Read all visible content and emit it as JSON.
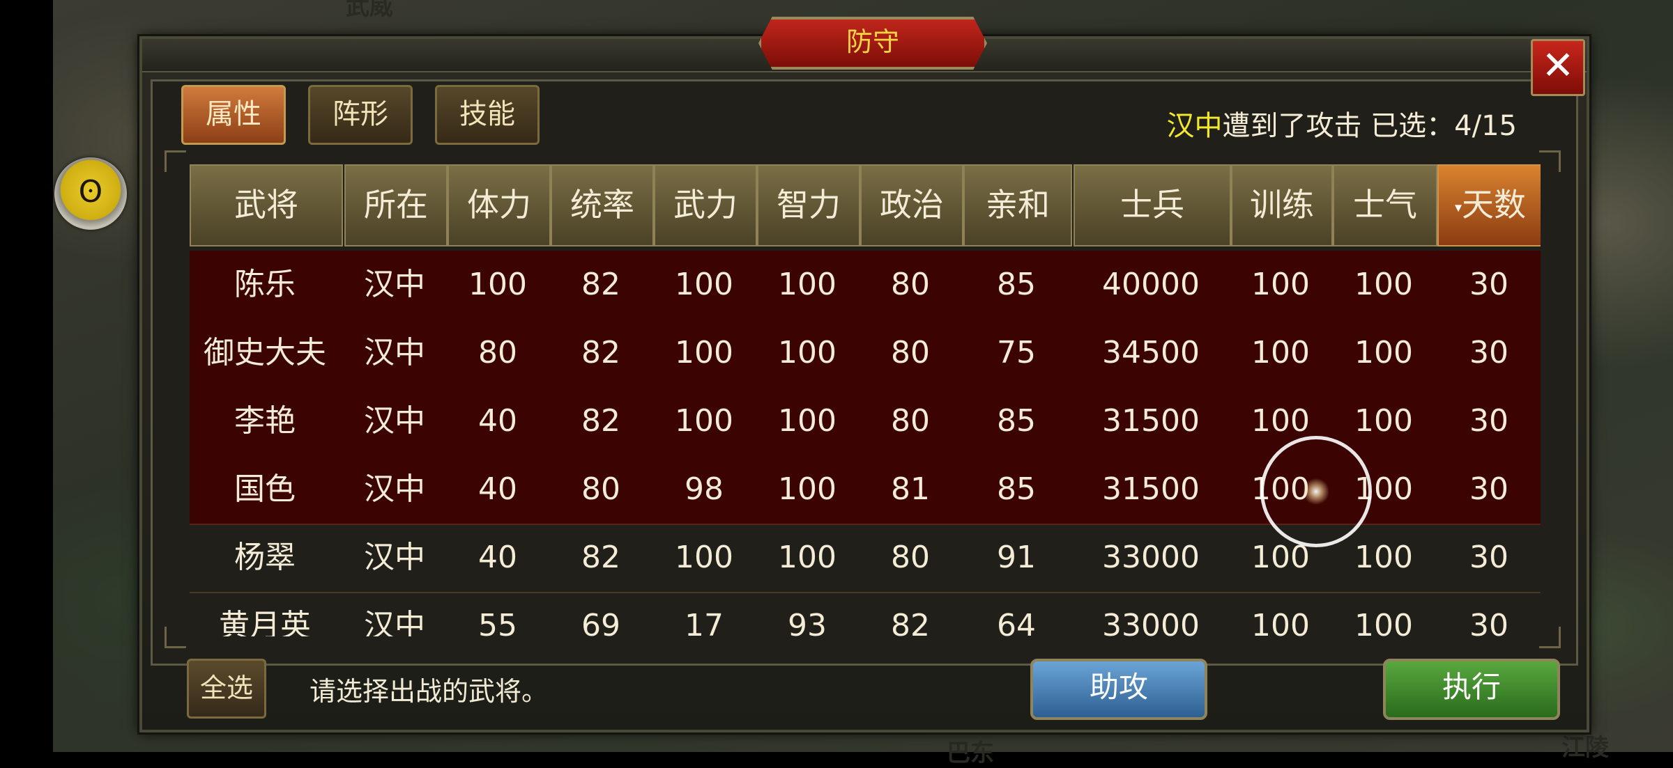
{
  "map": {
    "town_labels": [
      "武威",
      "江陵",
      "巴东"
    ]
  },
  "avatar_glyph": "ʘ",
  "dialog": {
    "title": "防守",
    "close_label": "✕",
    "tabs": [
      {
        "label": "属性",
        "active": true
      },
      {
        "label": "阵形",
        "active": false
      },
      {
        "label": "技能",
        "active": false
      }
    ],
    "status": {
      "city": "汉中",
      "attacked_text": "遭到了攻击",
      "selected_label": "已选：",
      "selected_count": "4/15"
    }
  },
  "table": {
    "columns": [
      "武将",
      "所在",
      "体力",
      "统率",
      "武力",
      "智力",
      "政治",
      "亲和",
      "士兵",
      "训练",
      "士气",
      "天数"
    ],
    "sorted_column": "天数",
    "sort_arrow": "▾",
    "rows": [
      {
        "selected": true,
        "cells": [
          "陈乐",
          "汉中",
          "100",
          "82",
          "100",
          "100",
          "80",
          "85",
          "40000",
          "100",
          "100",
          "30"
        ]
      },
      {
        "selected": true,
        "cells": [
          "御史大夫",
          "汉中",
          "80",
          "82",
          "100",
          "100",
          "80",
          "75",
          "34500",
          "100",
          "100",
          "30"
        ]
      },
      {
        "selected": true,
        "cells": [
          "李艳",
          "汉中",
          "40",
          "82",
          "100",
          "100",
          "80",
          "85",
          "31500",
          "100",
          "100",
          "30"
        ]
      },
      {
        "selected": true,
        "cells": [
          "国色",
          "汉中",
          "40",
          "80",
          "98",
          "100",
          "81",
          "85",
          "31500",
          "100",
          "100",
          "30"
        ]
      },
      {
        "selected": false,
        "cells": [
          "杨翠",
          "汉中",
          "40",
          "82",
          "100",
          "100",
          "80",
          "91",
          "33000",
          "100",
          "100",
          "30"
        ]
      },
      {
        "selected": false,
        "cells": [
          "黄月英",
          "汉中",
          "55",
          "69",
          "17",
          "93",
          "82",
          "64",
          "33000",
          "100",
          "100",
          "30"
        ]
      }
    ]
  },
  "footer": {
    "select_all_label": "全选",
    "hint": "请选择出战的武将。",
    "assist_label": "助攻",
    "execute_label": "执行"
  },
  "colors": {
    "selected_row": "#3b0403",
    "city_highlight": "#f3ea2c",
    "title_text": "#f6d442",
    "assist_button": "#2e5f92",
    "execute_button": "#2b6b1c",
    "sorted_header": "#d9822f"
  }
}
